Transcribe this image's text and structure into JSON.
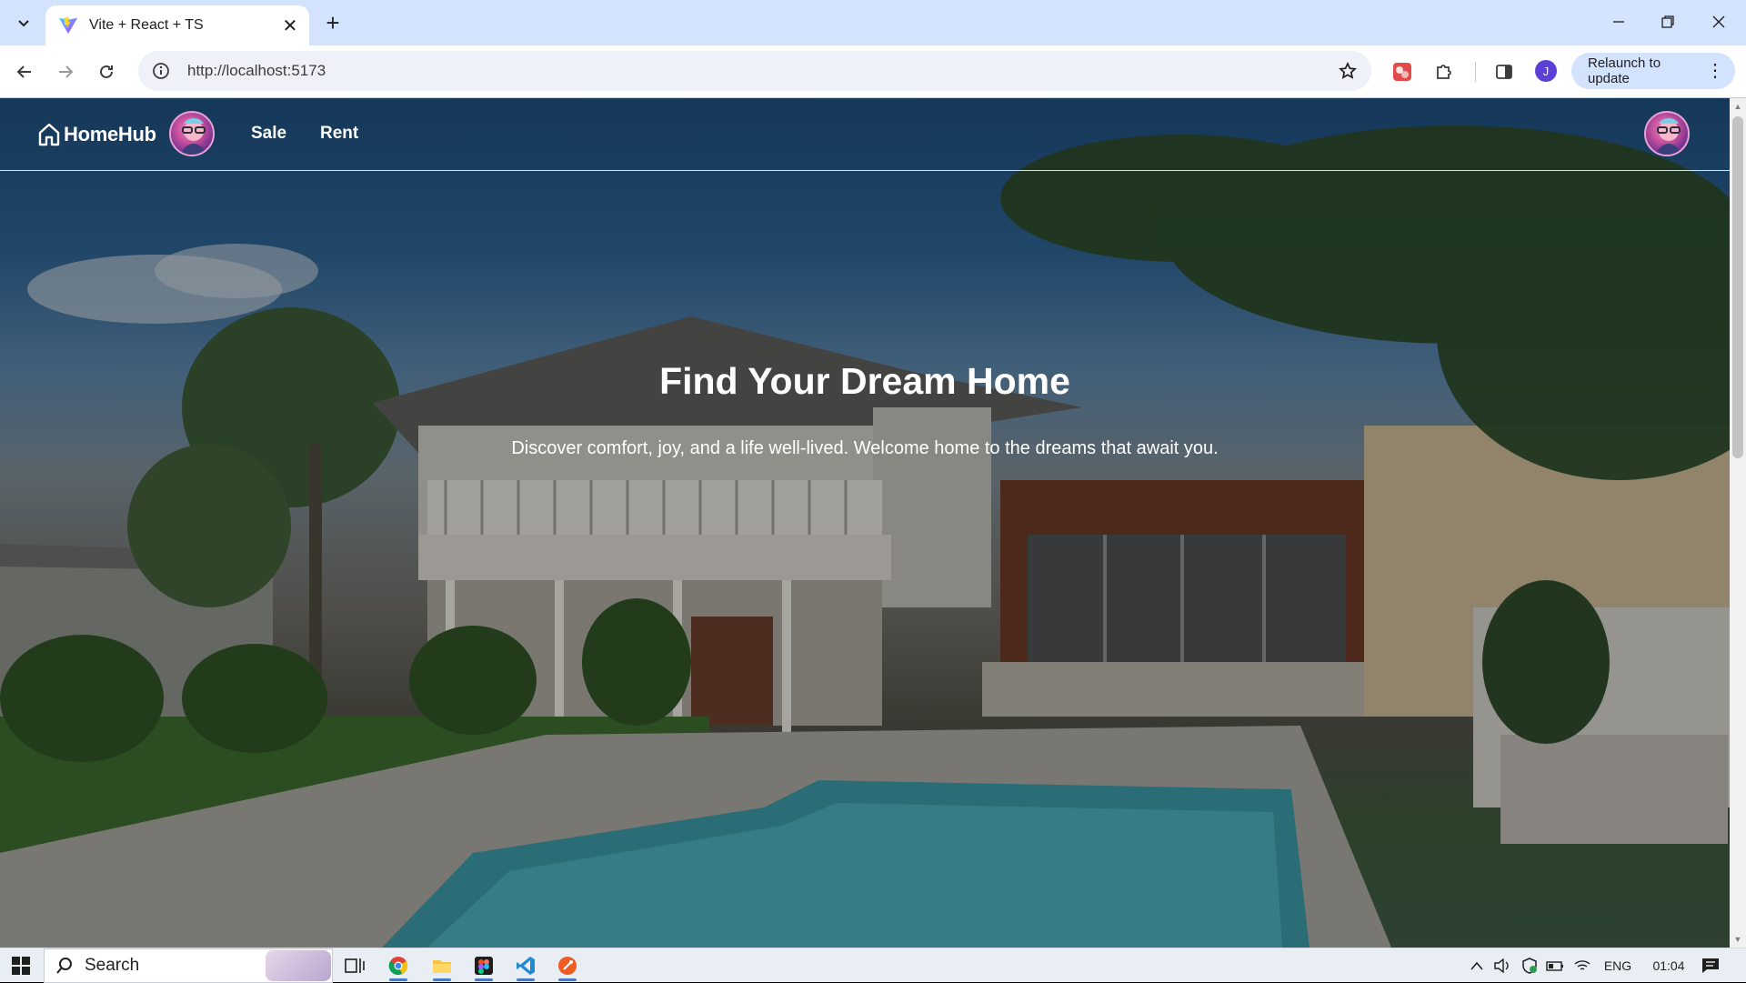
{
  "browser": {
    "tab_title": "Vite + React + TS",
    "url": "http://localhost:5173",
    "relaunch_label": "Relaunch to update",
    "profile_initial": "J"
  },
  "site": {
    "brand": "HomeHub",
    "nav": [
      "Sale",
      "Rent"
    ],
    "hero_title": "Find Your Dream Home",
    "hero_subtitle": "Discover comfort, joy, and a life well-lived. Welcome home to the dreams that await you."
  },
  "taskbar": {
    "search_label": "Search",
    "language": "ENG",
    "time": "01:04"
  },
  "colors": {
    "tabstrip": "#d3e3fd",
    "accent": "#4a78c2",
    "profile": "#5b3fd6"
  }
}
